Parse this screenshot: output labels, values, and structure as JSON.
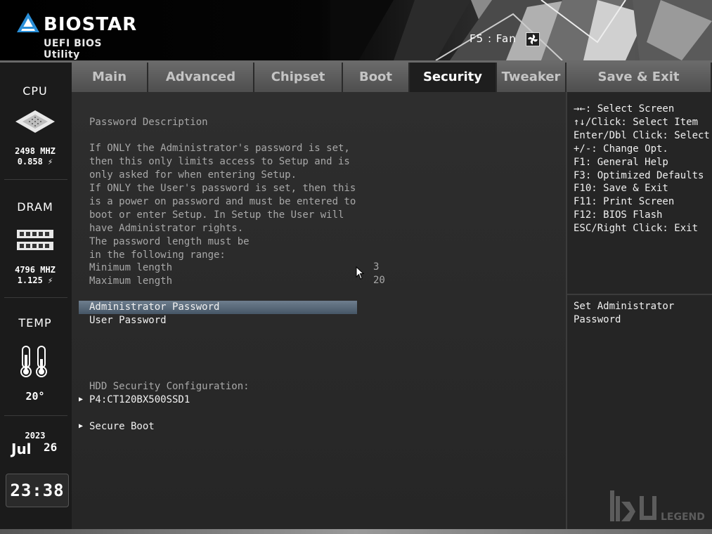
{
  "header": {
    "brand": "BIOSTAR",
    "subtitle": "UEFI BIOS Utility",
    "fan_hint": "F5 : Fan",
    "fan_icon": "fan-icon"
  },
  "sidebar": {
    "cpu": {
      "title": "CPU",
      "freq": "2498 MHZ",
      "volt": "0.858 ⚡",
      "icon": "cpu-chip-icon"
    },
    "dram": {
      "title": "DRAM",
      "freq": "4796 MHZ",
      "volt": "1.125 ⚡",
      "icon": "memory-module-icon"
    },
    "temp": {
      "title": "TEMP",
      "value": "20°",
      "icon": "thermometer-icon"
    },
    "date": {
      "year": "2023",
      "month": "Jul",
      "day": "26"
    },
    "clock": {
      "time": "23:38"
    }
  },
  "tabs": [
    {
      "label": "Main",
      "active": false
    },
    {
      "label": "Advanced",
      "active": false
    },
    {
      "label": "Chipset",
      "active": false
    },
    {
      "label": "Boot",
      "active": false
    },
    {
      "label": "Security",
      "active": true
    },
    {
      "label": "Tweaker",
      "active": false
    },
    {
      "label": "Save & Exit",
      "active": false
    }
  ],
  "main": {
    "heading": "Password Description",
    "description": [
      "If ONLY the Administrator's password is set,",
      "then this only limits access to Setup and is",
      "only asked for when entering Setup.",
      "If ONLY the User's password is set, then this",
      "is a power on password and must be entered to",
      "boot or enter Setup. In Setup the User will",
      "have Administrator rights.",
      "The password length must be",
      "in the following range:"
    ],
    "min_label": "Minimum length",
    "min_value": "3",
    "max_label": "Maximum length",
    "max_value": "20",
    "admin_password": "Administrator Password",
    "user_password": "User Password",
    "hdd_heading": "HDD Security Configuration:",
    "hdd_device": "P4:CT120BX500SSD1",
    "secure_boot": "Secure Boot"
  },
  "help": {
    "keys": [
      "→←: Select Screen",
      "↑↓/Click: Select Item",
      "Enter/Dbl Click: Select",
      "+/-: Change Opt.",
      "F1: General Help",
      "F3: Optimized Defaults",
      "F10: Save & Exit",
      "F11: Print Screen",
      "F12: BIOS Flash",
      "ESC/Right Click: Exit"
    ],
    "description": [
      "Set Administrator",
      "Password"
    ]
  },
  "watermark": {
    "text": "LEGEND"
  }
}
